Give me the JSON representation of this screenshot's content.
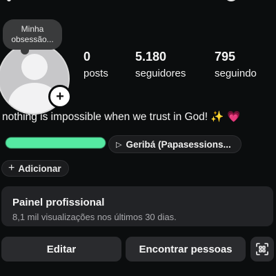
{
  "profile": {
    "note": "Minha obsessão...",
    "add_story_symbol": "+",
    "stats": [
      {
        "count": "0",
        "label": "posts"
      },
      {
        "count": "5.180",
        "label": "seguidores"
      },
      {
        "count": "795",
        "label": "seguindo"
      }
    ],
    "bio_text": "nothing is impossible when we trust in God!",
    "bio_emoji_sparkles": "✨",
    "bio_emoji_heart": "💗"
  },
  "links": {
    "music_chip": "Geribá (Papasessions...",
    "add_chip": "Adicionar"
  },
  "professional_panel": {
    "title": "Painel profissional",
    "subtitle": "8,1 mil visualizações nos últimos 30 dias."
  },
  "actions": {
    "edit": "Editar",
    "find_people": "Encontrar pessoas"
  },
  "icons": {
    "add_story": "plus-icon",
    "music": "play-icon",
    "add": "plus-icon",
    "qr": "qr-code-icon",
    "avatar": "default-avatar-icon"
  },
  "colors": {
    "background": "#0b0d0e",
    "redacted_link": "#55e9a2",
    "heart": "#ff4fc2",
    "button_bg": "#2a2b2e"
  }
}
